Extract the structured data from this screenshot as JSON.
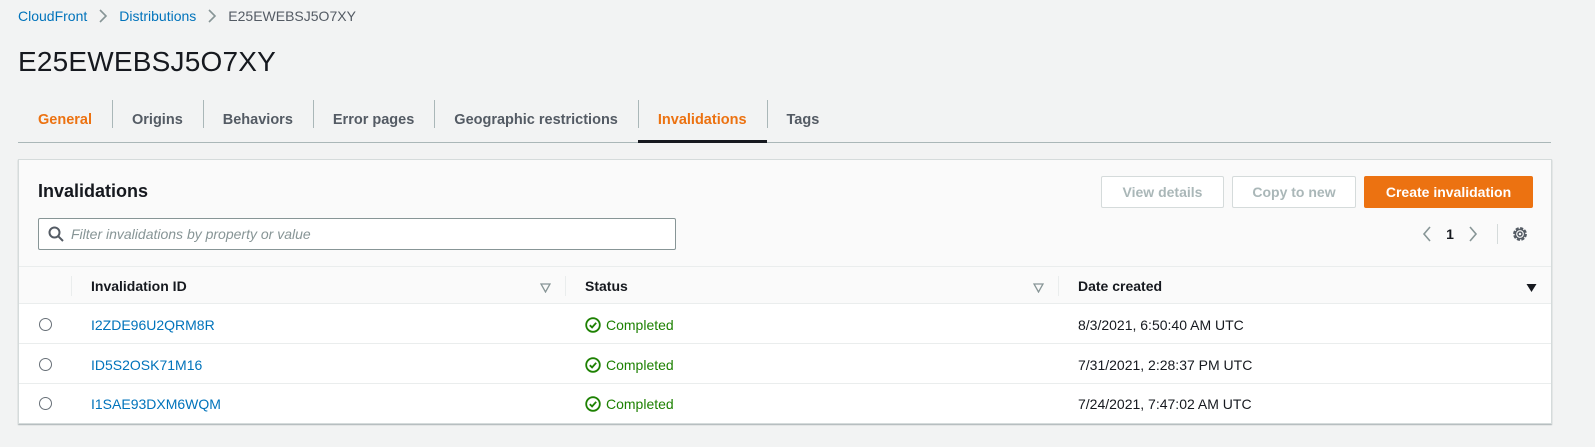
{
  "breadcrumb": {
    "items": [
      "CloudFront",
      "Distributions"
    ],
    "current": "E25EWEBSJ5O7XY"
  },
  "page": {
    "title": "E25EWEBSJ5O7XY"
  },
  "tabs": [
    {
      "label": "General"
    },
    {
      "label": "Origins"
    },
    {
      "label": "Behaviors"
    },
    {
      "label": "Error pages"
    },
    {
      "label": "Geographic restrictions"
    },
    {
      "label": "Invalidations"
    },
    {
      "label": "Tags"
    }
  ],
  "active_tab": "Invalidations",
  "panel": {
    "title": "Invalidations",
    "buttons": {
      "view_details": "View details",
      "copy_to_new": "Copy to new",
      "create": "Create invalidation"
    },
    "search_placeholder": "Filter invalidations by property or value",
    "page_number": "1"
  },
  "table": {
    "headers": {
      "id": "Invalidation ID",
      "status": "Status",
      "date": "Date created"
    },
    "rows": [
      {
        "id": "I2ZDE96U2QRM8R",
        "status": "Completed",
        "date": "8/3/2021, 6:50:40 AM UTC"
      },
      {
        "id": "ID5S2OSK71M16",
        "status": "Completed",
        "date": "7/31/2021, 2:28:37 PM UTC"
      },
      {
        "id": "I1SAE93DXM6WQM",
        "status": "Completed",
        "date": "7/24/2021, 7:47:02 AM UTC"
      }
    ]
  },
  "colors": {
    "accent": "#ec7211",
    "link": "#0073bb",
    "success": "#1d8102"
  }
}
